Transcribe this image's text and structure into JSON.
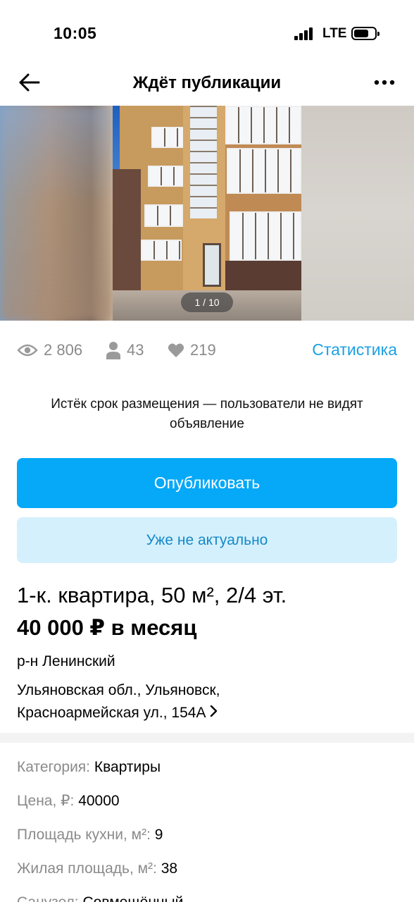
{
  "status_bar": {
    "time": "10:05",
    "network": "LTE"
  },
  "header": {
    "title": "Ждёт публикации"
  },
  "gallery": {
    "counter": "1 / 10"
  },
  "stats": {
    "views": "2 806",
    "contacts": "43",
    "favorites": "219",
    "link": "Статистика"
  },
  "notice": "Истёк срок размещения — пользователи не видят объявление",
  "buttons": {
    "publish": "Опубликовать",
    "not_actual": "Уже не актуально"
  },
  "listing": {
    "title": "1-к. квартира, 50 м², 2/4 эт.",
    "price": "40 000 ₽ в месяц",
    "district": "р-н Ленинский",
    "address_line1": "Ульяновская обл., Ульяновск,",
    "address_line2": "Красноармейская ул., 154А"
  },
  "params": [
    {
      "key": "Категория:",
      "value": "Квартиры"
    },
    {
      "key": "Цена, ₽:",
      "value": "40000"
    },
    {
      "key": "Площадь кухни, м²:",
      "value": "9"
    },
    {
      "key": "Жилая площадь, м²:",
      "value": "38"
    },
    {
      "key": "Санузел:",
      "value": "Совмещённый"
    }
  ]
}
